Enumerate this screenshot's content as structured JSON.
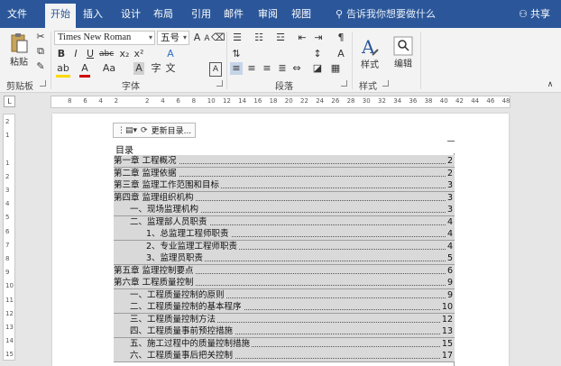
{
  "tabs": [
    {
      "label": "文件",
      "name": "tab-file",
      "active": false
    },
    {
      "label": "开始",
      "name": "tab-home",
      "active": true
    },
    {
      "label": "插入",
      "name": "tab-insert",
      "active": false
    },
    {
      "label": "设计",
      "name": "tab-design",
      "active": false
    },
    {
      "label": "布局",
      "name": "tab-layout",
      "active": false
    },
    {
      "label": "引用",
      "name": "tab-references",
      "active": false
    },
    {
      "label": "邮件",
      "name": "tab-mailings",
      "active": false
    },
    {
      "label": "审阅",
      "name": "tab-review",
      "active": false
    },
    {
      "label": "视图",
      "name": "tab-view",
      "active": false
    }
  ],
  "tellme": {
    "placeholder": "告诉我你想要做什么"
  },
  "share": {
    "label": "共享"
  },
  "ribbon": {
    "clipboard": {
      "paste_label": "粘贴",
      "group_label": "剪贴板"
    },
    "font": {
      "font_name": "Times New Roman",
      "font_size": "五号",
      "group_label": "字体"
    },
    "paragraph": {
      "group_label": "段落"
    },
    "styles": {
      "label": "样式",
      "group_label": "样式"
    },
    "editing": {
      "label": "编辑"
    }
  },
  "ruler": {
    "marks": [
      "8",
      "6",
      "4",
      "2",
      "",
      "2",
      "4",
      "6",
      "8",
      "10",
      "12",
      "14",
      "16",
      "18",
      "20",
      "22",
      "24",
      "26",
      "28",
      "30",
      "32",
      "34",
      "36",
      "38",
      "40",
      "42",
      "44",
      "46",
      "48"
    ],
    "vmarks": [
      "2",
      "1",
      "",
      "1",
      "2",
      "3",
      "4",
      "5",
      "6",
      "7",
      "8",
      "9",
      "10",
      "11",
      "12",
      "13",
      "14",
      "15"
    ]
  },
  "toc_control": {
    "update_label": "更新目录..."
  },
  "toc": {
    "title": "目录",
    "entries": [
      {
        "label": "第一章   工程概况",
        "page": "2",
        "level": 1
      },
      {
        "label": "第二章   监理依据",
        "page": "2",
        "level": 1
      },
      {
        "label": "第三章   监理工作范围和目标",
        "page": "3",
        "level": 1
      },
      {
        "label": "第四章   监理组织机构",
        "page": "3",
        "level": 1
      },
      {
        "label": "一、现场监理机构",
        "page": "3",
        "level": 2
      },
      {
        "label": "二、监理部人员职责",
        "page": "4",
        "level": 2
      },
      {
        "label": "1、总监理工程师职责",
        "page": "4",
        "level": 3
      },
      {
        "label": "2、专业监理工程师职责",
        "page": "4",
        "level": 3
      },
      {
        "label": "3、监理员职责",
        "page": "5",
        "level": 3
      },
      {
        "label": "第五章   监理控制要点",
        "page": "6",
        "level": 1
      },
      {
        "label": "第六章   工程质量控制",
        "page": "9",
        "level": 1
      },
      {
        "label": "一、工程质量控制的原则",
        "page": "9",
        "level": 2
      },
      {
        "label": "二、工程质量控制的基本程序",
        "page": "10",
        "level": 2
      },
      {
        "label": "三、工程质量控制方法",
        "page": "12",
        "level": 2
      },
      {
        "label": "四、工程质量事前预控措施",
        "page": "13",
        "level": 2
      },
      {
        "label": "五、施工过程中的质量控制措施",
        "page": "15",
        "level": 2
      },
      {
        "label": "六、工程质量事后把关控制",
        "page": "17",
        "level": 2
      }
    ]
  },
  "colors": {
    "accent": "#2b579a",
    "toc_field": "#d9d9d9"
  }
}
